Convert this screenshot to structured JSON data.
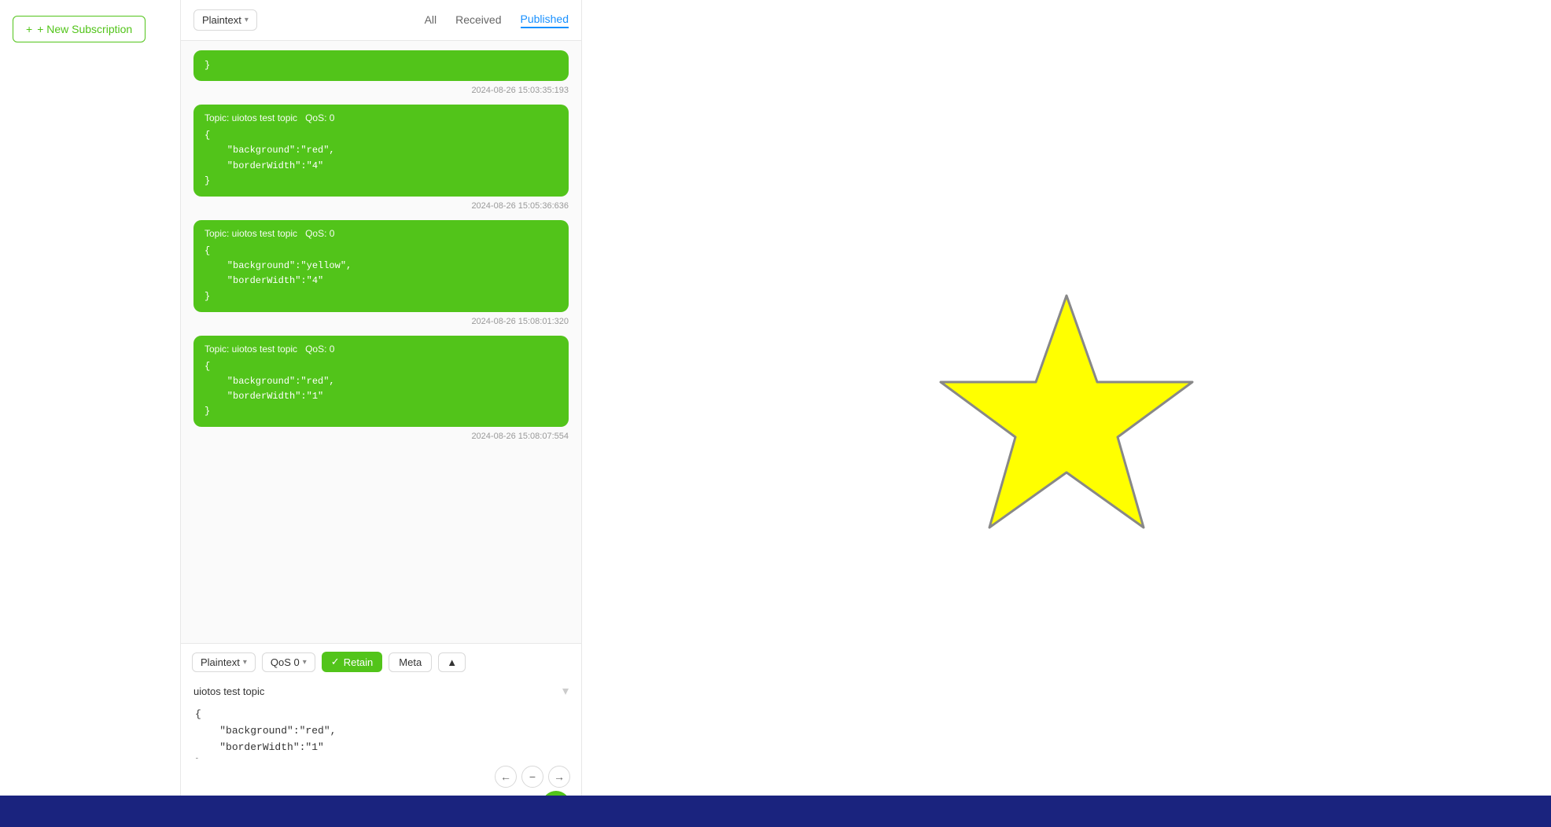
{
  "header": {
    "new_subscription_label": "+ New Subscription",
    "format_label": "Plaintext",
    "tabs": [
      {
        "id": "all",
        "label": "All",
        "active": false
      },
      {
        "id": "received",
        "label": "Received",
        "active": false
      },
      {
        "id": "published",
        "label": "Published",
        "active": true
      }
    ]
  },
  "messages": [
    {
      "id": "msg1",
      "topic": "Topic: uiotos test topic",
      "qos": "QoS: 0",
      "body": "{\n    \"background\":\"red\",\n    \"borderWidth\":\"4\"\n}",
      "timestamp": "2024-08-26 15:05:36:636"
    },
    {
      "id": "msg2",
      "topic": "Topic: uiotos test topic",
      "qos": "QoS: 0",
      "body": "{\n    \"background\":\"yellow\",\n    \"borderWidth\":\"4\"\n}",
      "timestamp": "2024-08-26 15:08:01:320"
    },
    {
      "id": "msg3",
      "topic": "Topic: uiotos test topic",
      "qos": "QoS: 0",
      "body": "{\n    \"background\":\"red\",\n    \"borderWidth\":\"1\"\n}",
      "timestamp": "2024-08-26 15:08:07:554"
    }
  ],
  "compose": {
    "format_label": "Plaintext",
    "qos_label": "QoS 0",
    "retain_label": "Retain",
    "meta_label": "Meta",
    "topic_value": "uiotos test topic",
    "message_value": "{\n    \"background\":\"red\",\n    \"borderWidth\":\"1\"\n}",
    "nav": {
      "prev": "←",
      "minus": "−",
      "next": "→"
    }
  },
  "star": {
    "fill": "#FFFF00",
    "stroke": "#888888",
    "stroke_width": "3"
  },
  "taskbar": {
    "items": []
  }
}
